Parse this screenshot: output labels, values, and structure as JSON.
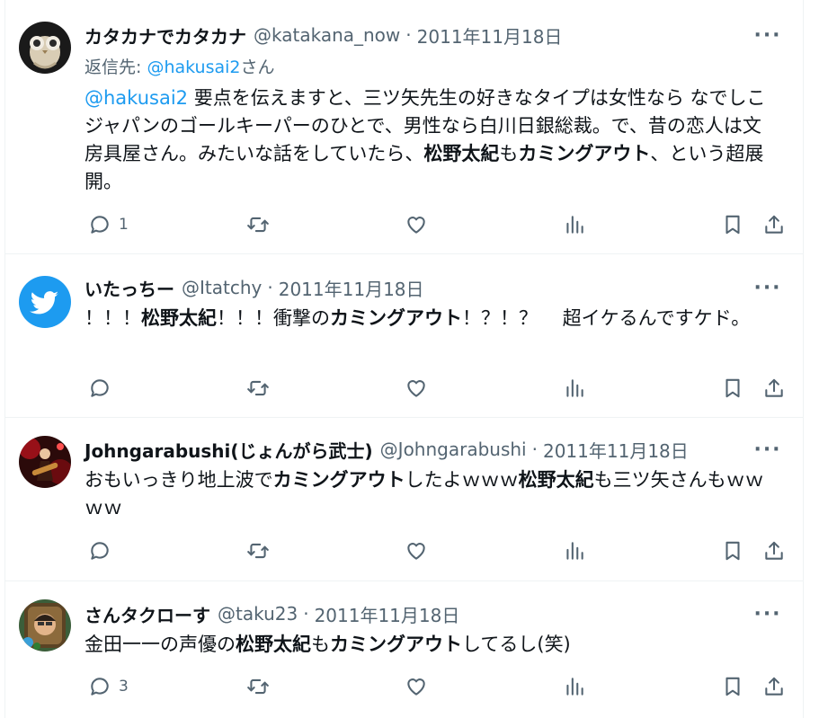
{
  "tweets": [
    {
      "name": "カタカナでカタカナ",
      "handle": "@katakana_now",
      "sep": "·",
      "date": "2011年11月18日",
      "reply_prefix": "返信先: ",
      "reply_handle": "@hakusai2",
      "reply_suffix": "さん",
      "body": {
        "mention": "@hakusai2",
        "t1": " 要点を伝えますと、三ツ矢先生の好きなタイプは女性なら なでしこジャパンのゴールキーパーのひとで、男性なら白川日銀総裁。で、昔の恋人は文房具屋さん。みたいな話をしていたら、",
        "b1": "松野太紀",
        "t2": "も",
        "b2": "カミングアウト",
        "t3": "、という超展開。"
      },
      "reply_count": "1",
      "avatar": "owl-avatar"
    },
    {
      "name": "いたっちー",
      "handle": "@Itatchy",
      "sep": "·",
      "date": "2011年11月18日",
      "body": {
        "t1": "！！！",
        "b1": "松野太紀",
        "t2": "！！！衝撃の",
        "b2": "カミングアウト",
        "t3": "！？！？　 超イケるんですケド。"
      },
      "reply_count": "",
      "avatar": "twitter-bird-avatar"
    },
    {
      "name": "Johngarabushi(じょんがら武士)",
      "handle": "@Johngarabushi",
      "sep": "·",
      "date": "2011年11月18日",
      "body": {
        "t1": "おもいっきり地上波で",
        "b1": "カミングアウト",
        "t2": "したよｗｗｗ",
        "b2": "松野太紀",
        "t3": "も三ツ矢さんもｗｗｗｗ"
      },
      "reply_count": "",
      "avatar": "guitarist-avatar"
    },
    {
      "name": "さんタクローす",
      "handle": "@taku23",
      "sep": "·",
      "date": "2011年11月18日",
      "body": {
        "t1": "金田一一の声優の",
        "b1": "松野太紀",
        "t2": "も",
        "b2": "カミングアウト",
        "t3": "してるし(笑)"
      },
      "reply_count": "3",
      "avatar": "man-portrait-avatar"
    }
  ],
  "more_label": "···",
  "colors": {
    "text": "#0f1419",
    "secondary": "#536471",
    "link": "#1d9bf0",
    "divider": "#eff3f4"
  },
  "icons": [
    "reply-icon",
    "retweet-icon",
    "like-icon",
    "views-icon",
    "bookmark-icon",
    "share-icon"
  ]
}
